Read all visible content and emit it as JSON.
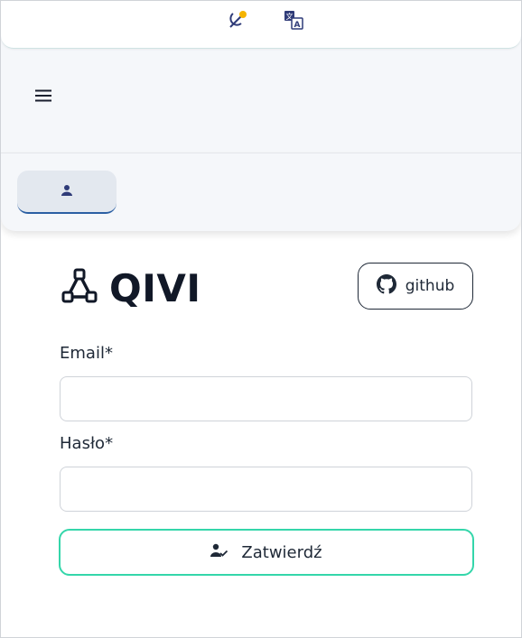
{
  "toolbar": {
    "theme_icon": "theme-toggle-icon",
    "language_icon": "translate-icon",
    "theme_badge_color": "#f5b400",
    "icon_color": "#2f3b78"
  },
  "menu": {
    "icon": "hamburger-menu-icon"
  },
  "tabs": [
    {
      "icon": "user-icon",
      "active": true
    }
  ],
  "brand": {
    "icon": "graph-nodes-icon",
    "title": "QIVI"
  },
  "github": {
    "label": "github",
    "icon": "github-icon"
  },
  "form": {
    "email_label": "Email*",
    "email_value": "",
    "password_label": "Hasło*",
    "password_value": "",
    "submit_label": "Zatwierdź",
    "submit_icon": "user-check-icon",
    "submit_border_color": "#34d6aa"
  }
}
